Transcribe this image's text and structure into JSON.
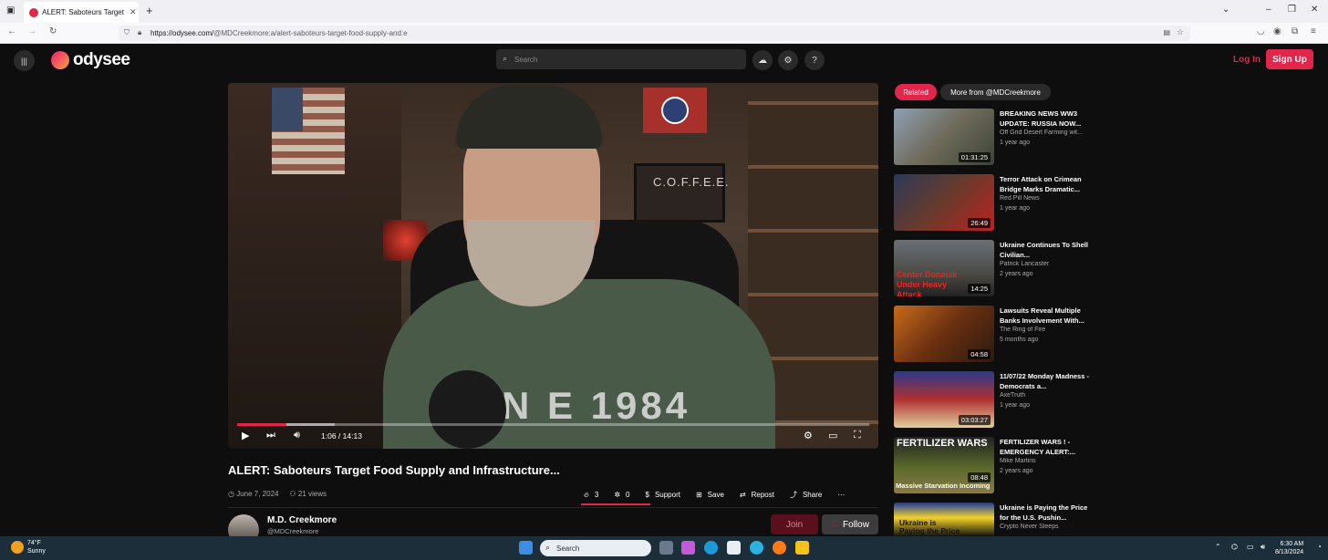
{
  "browser": {
    "tab_title": "ALERT: Saboteurs Target Food S",
    "url_host": "https://odysee.com/",
    "url_path": "@MDCreekmore:a/alert-saboteurs-target-food-supply-and:e"
  },
  "header": {
    "logo_text": "odysee",
    "search_placeholder": "Search",
    "login_label": "Log In",
    "signup_label": "Sign Up"
  },
  "player": {
    "shirt_text": "N E 1984",
    "sign_text": "C.O.F.F.E.E.",
    "current_time": "1:06",
    "time_sep": "/",
    "duration": "14:13",
    "progress_fraction": 0.0774
  },
  "video": {
    "title": "ALERT: Saboteurs Target Food Supply and Infrastructure...",
    "date": "June 7, 2024",
    "views": "21 views",
    "fire_count": "3",
    "slime_count": "0",
    "support_label": "Support",
    "save_label": "Save",
    "repost_label": "Repost",
    "share_label": "Share"
  },
  "channel": {
    "name": "M.D. Creekmore",
    "handle": "@MDCreekmore",
    "join_label": "Join",
    "follow_label": "Follow"
  },
  "sidebar": {
    "related_tab": "Related",
    "more_tab": "More from @MDCreekmore",
    "items": [
      {
        "title": "BREAKING NEWS WW3 UPDATE: RUSSIA NOW...",
        "channel": "Off Grid Desert Farming wit...",
        "ago": "1 year ago",
        "duration": "01:31:25"
      },
      {
        "title": "Terror Attack on Crimean Bridge Marks Dramatic...",
        "channel": "Red Pill News",
        "ago": "1 year ago",
        "duration": "26:49"
      },
      {
        "title": "Ukraine Continues To Shell Civilian...",
        "channel": "Patrick Lancaster",
        "ago": "2 years ago",
        "duration": "14:25",
        "thumb_text": "Center Donetsk Under Heavy Attack"
      },
      {
        "title": "Lawsuits Reveal Multiple Banks Involvement With...",
        "channel": "The Ring of Fire",
        "ago": "5 months ago",
        "duration": "04:58"
      },
      {
        "title": "11/07/22 Monday Madness - Democrats a...",
        "channel": "AxeTruth",
        "ago": "1 year ago",
        "duration": "03:03:27"
      },
      {
        "title": "FERTILIZER WARS ! - EMERGENCY ALERT:...",
        "channel": "Mike Martins",
        "ago": "2 years ago",
        "duration": "08:48",
        "thumb_text": "FERTILIZER WARS",
        "thumb_sub": "Massive Starvation Incoming"
      },
      {
        "title": "Ukraine is Paying the Price for the U.S. Pushin...",
        "channel": "Crypto Never Sleeps",
        "ago": "",
        "duration": "",
        "thumb_text": "Ukraine is Paying the Price for the"
      }
    ]
  },
  "taskbar": {
    "temp": "74°F",
    "condition": "Sunny",
    "search_label": "Search",
    "time": "6:30 AM",
    "date": "8/13/2024"
  },
  "colors": {
    "accent": "#e2254a",
    "background": "#0e0e0e"
  }
}
